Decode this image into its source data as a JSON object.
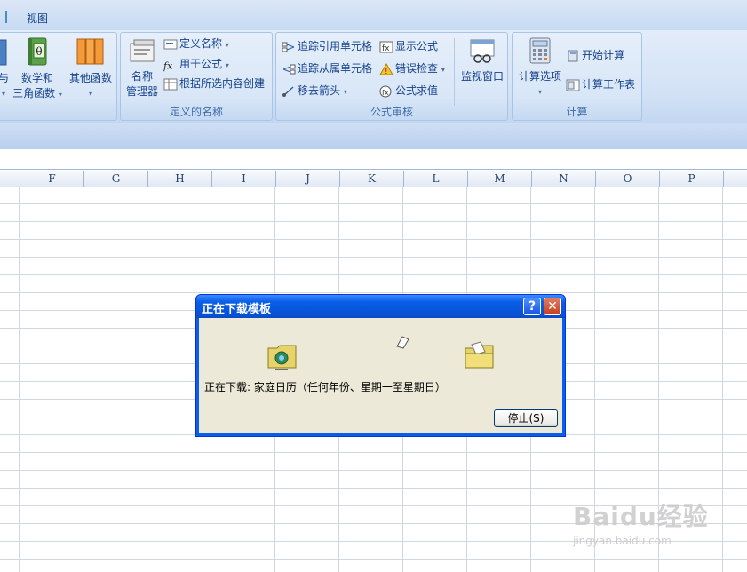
{
  "ribbon_tabs": {
    "view": "视图"
  },
  "formula_group": {
    "partial_btn_1": "与",
    "partial_btn_1b": "▾",
    "math_label_1": "数学和",
    "math_label_2": "三角函数",
    "other_label_1": "其他函数",
    "other_arrow": "▾"
  },
  "defined_names": {
    "name_manager_1": "名称",
    "name_manager_2": "管理器",
    "define_name": "定义名称",
    "use_in_formula": "用于公式",
    "create_from_selection": "根据所选内容创建",
    "label": "定义的名称"
  },
  "formula_auditing": {
    "trace_precedents": "追踪引用单元格",
    "trace_dependents": "追踪从属单元格",
    "remove_arrows": "移去箭头",
    "show_formulas": "显示公式",
    "error_checking": "错误检查",
    "evaluate_formula": "公式求值",
    "watch_window": "监视窗口",
    "label": "公式审核"
  },
  "calculation": {
    "calc_options": "计算选项",
    "calc_now": "开始计算",
    "calc_sheet": "计算工作表",
    "label": "计算"
  },
  "columns": [
    "F",
    "G",
    "H",
    "I",
    "J",
    "K",
    "L",
    "M",
    "N",
    "O",
    "P"
  ],
  "dialog": {
    "title": "正在下载模板",
    "help": "?",
    "close": "✕",
    "status_prefix": "正在下载:",
    "status_item": "家庭日历（任何年份、星期一至星期日）",
    "stop_button": "停止(S)"
  },
  "watermark": {
    "main": "Baidu经验",
    "sub": "jingyan.baidu.com"
  }
}
